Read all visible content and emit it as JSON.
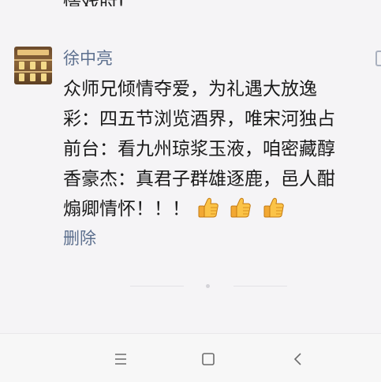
{
  "previous_post": {
    "cut_text": "情戏时!"
  },
  "post": {
    "author": "徐中亮",
    "content_lines": [
      "众师兄倾情夺爱，为礼遇大放逸",
      "彩：四五节浏览酒界，唯宋河独占",
      "前台：看九州琼浆玉液，咱密藏醇",
      "香豪杰：真君子群雄逐鹿，邑人酣",
      "煽卿情怀！！！"
    ],
    "emoji": [
      "thumbs-up-icon",
      "thumbs-up-icon",
      "thumbs-up-icon"
    ],
    "delete_label": "删除"
  },
  "nav_bar": {
    "buttons": [
      "menu-icon",
      "home-icon",
      "back-icon"
    ]
  },
  "colors": {
    "link": "#5c6f8e",
    "background": "#f5f4f6",
    "navbar": "#f7f7f7"
  }
}
